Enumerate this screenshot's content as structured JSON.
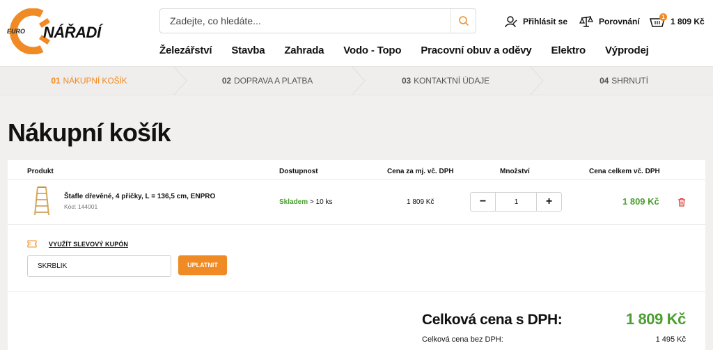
{
  "header": {
    "logo": {
      "prefix": "EURO",
      "brand": "NÁŘADÍ"
    },
    "search": {
      "placeholder": "Zadejte, co hledáte..."
    },
    "login_label": "Přihlásit se",
    "compare_label": "Porovnání",
    "cart_total": "1 809 Kč",
    "cart_count": "1"
  },
  "nav": [
    "Železářství",
    "Stavba",
    "Zahrada",
    "Vodo - Topo",
    "Pracovní obuv a oděvy",
    "Elektro",
    "Výprodej"
  ],
  "steps": [
    {
      "num": "01",
      "label": "NÁKUPNÍ KOŠÍK",
      "active": true
    },
    {
      "num": "02",
      "label": "DOPRAVA A PLATBA",
      "active": false
    },
    {
      "num": "03",
      "label": "KONTAKTNÍ ÚDAJE",
      "active": false
    },
    {
      "num": "04",
      "label": "SHRNUTÍ",
      "active": false
    }
  ],
  "page_title": "Nákupní košík",
  "table": {
    "headers": {
      "product": "Produkt",
      "availability": "Dostupnost",
      "unit_price": "Cena za mj. vč. DPH",
      "quantity": "Množství",
      "total": "Cena celkem vč. DPH"
    },
    "items": [
      {
        "name": "Štafle dřevěné, 4 příčky, L = 136,5 cm, ENPRO",
        "code": "Kód: 144001",
        "stock_status": "Skladem",
        "stock_detail": "> 10 ks",
        "unit_price": "1 809 Kč",
        "quantity": "1",
        "total": "1 809 Kč"
      }
    ]
  },
  "coupon": {
    "link_label": "VYUŽÍT SLEVOVÝ KUPÓN",
    "value": "SKRBLÍK",
    "apply_label": "UPLATNIT"
  },
  "summary": {
    "total_label": "Celková cena s DPH:",
    "total_value": "1 809 Kč",
    "net_label": "Celková cena bez DPH:",
    "net_value": "1 495 Kč"
  },
  "colors": {
    "accent": "#f08a24",
    "price_green": "#4a9e2f",
    "delete_red": "#d9322b"
  }
}
